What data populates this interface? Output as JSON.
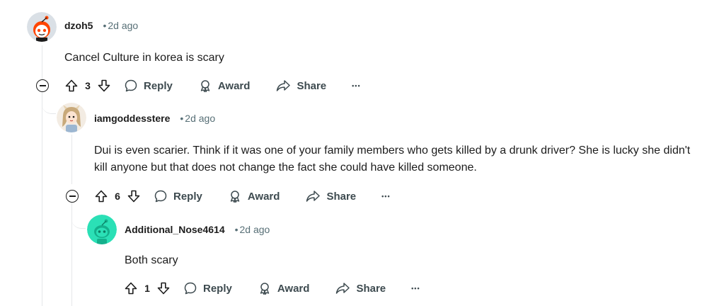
{
  "comments": [
    {
      "username": "dzoh5",
      "separator": "•",
      "time": "2d ago",
      "body": "Cancel Culture in korea is scary",
      "votes": "3",
      "actions": {
        "reply": "Reply",
        "award": "Award",
        "share": "Share",
        "more": "•••"
      }
    },
    {
      "username": "iamgoddesstere",
      "separator": "•",
      "time": "2d ago",
      "body": "Dui is even scarier. Think if it was one of your family members who gets killed by a drunk driver? She is lucky she didn't kill anyone but that does not change the fact she could have killed someone.",
      "votes": "6",
      "actions": {
        "reply": "Reply",
        "award": "Award",
        "share": "Share",
        "more": "•••"
      }
    },
    {
      "username": "Additional_Nose4614",
      "separator": "•",
      "time": "2d ago",
      "body": "Both scary",
      "votes": "1",
      "actions": {
        "reply": "Reply",
        "award": "Award",
        "share": "Share",
        "more": "•••"
      }
    }
  ],
  "colors": {
    "text": "#1c1c1c",
    "meta": "#576f76",
    "thread_line": "#e5e7e9",
    "snoo_teal": "#2be0b6",
    "snoo_orange": "#ff4500"
  }
}
